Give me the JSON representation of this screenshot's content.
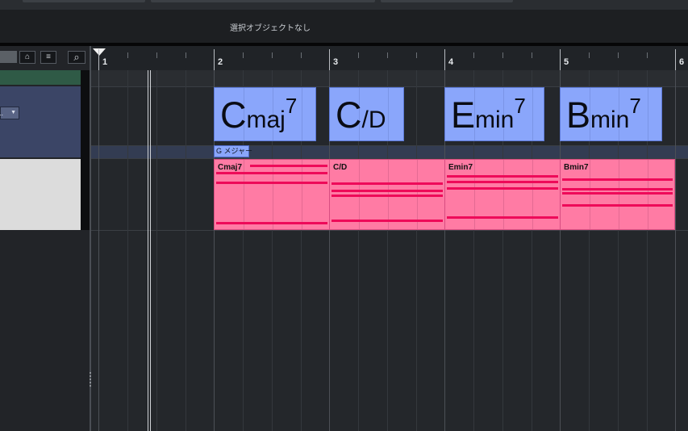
{
  "info_line": {
    "status_text": "選択オブジェクトなし"
  },
  "left_panel": {
    "toolbar": {
      "btn1_icon": "⌂",
      "btn2_icon": "≡",
      "search_icon": "⌕"
    },
    "chord_track": {
      "dropdown_value": "..",
      "dropdown_arrow": "▼"
    }
  },
  "ruler": {
    "bars": [
      "1",
      "2",
      "3",
      "4",
      "5",
      "6"
    ]
  },
  "chord_track": {
    "events": [
      {
        "root": "C",
        "quality": "maj",
        "extension": "7",
        "bar": 2
      },
      {
        "root": "C",
        "quality": "/D",
        "extension": "",
        "bar": 3
      },
      {
        "root": "E",
        "quality": "min",
        "extension": "7",
        "bar": 4
      },
      {
        "root": "B",
        "quality": "min",
        "extension": "7",
        "bar": 5
      }
    ],
    "scale_event": "G メジャー"
  },
  "instrument_track": {
    "parts": [
      {
        "name": "Cmaj7",
        "bar": 2
      },
      {
        "name": "C/D",
        "bar": 3
      },
      {
        "name": "Emin7",
        "bar": 4
      },
      {
        "name": "Bmin7",
        "bar": 5
      }
    ]
  },
  "colors": {
    "chord_event": "#8aa6fb",
    "midi_part": "#ff7ba4",
    "midi_note": "#ee0a59",
    "track_green": "#2f5a46",
    "chord_track_header": "#3b4566"
  }
}
